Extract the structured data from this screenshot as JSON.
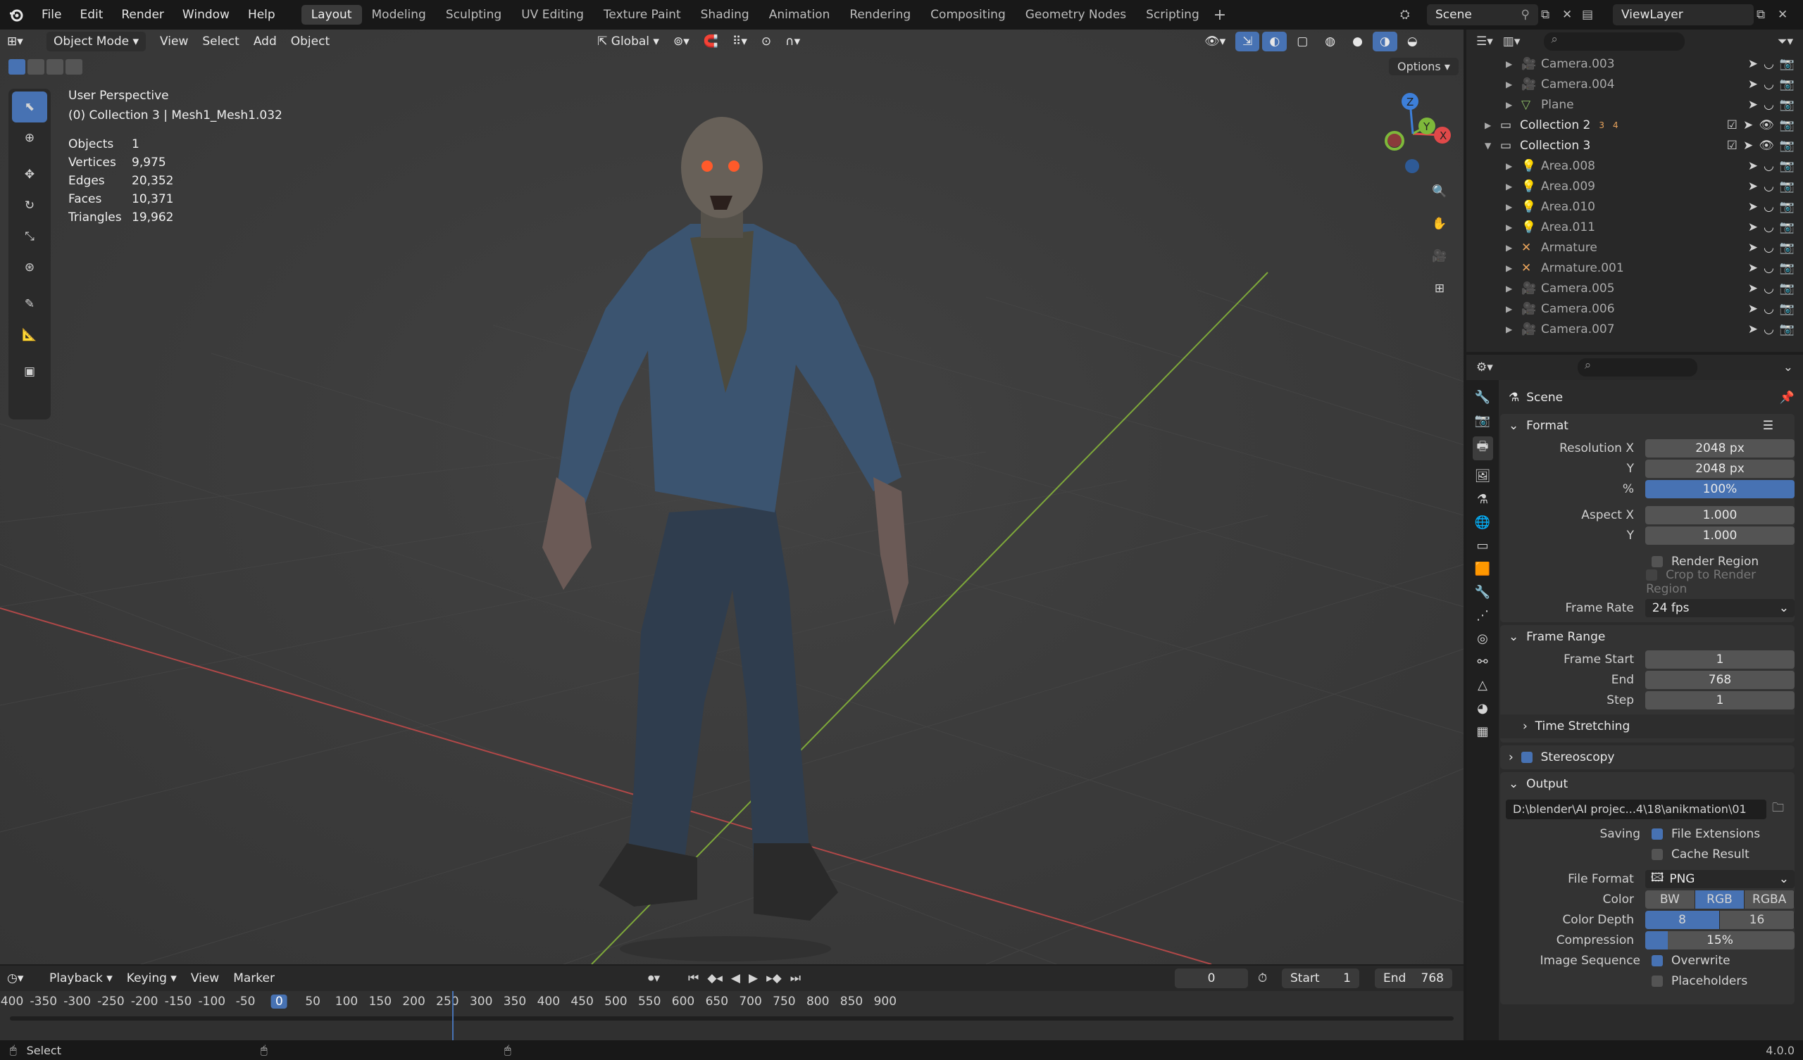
{
  "app": {
    "version": "4.0.0"
  },
  "menu": [
    "File",
    "Edit",
    "Render",
    "Window",
    "Help"
  ],
  "workspaces": [
    {
      "label": "Layout",
      "active": true
    },
    {
      "label": "Modeling"
    },
    {
      "label": "Sculpting"
    },
    {
      "label": "UV Editing"
    },
    {
      "label": "Texture Paint"
    },
    {
      "label": "Shading"
    },
    {
      "label": "Animation"
    },
    {
      "label": "Rendering"
    },
    {
      "label": "Compositing"
    },
    {
      "label": "Geometry Nodes"
    },
    {
      "label": "Scripting"
    }
  ],
  "scene_selector": "Scene",
  "view_layer": "ViewLayer",
  "viewport_header": {
    "mode": "Object Mode",
    "menus": [
      "View",
      "Select",
      "Add",
      "Object"
    ],
    "orientation": "Global",
    "options": "Options"
  },
  "viewport": {
    "perspective": "User Perspective",
    "context": "(0) Collection 3 | Mesh1_Mesh1.032",
    "stats": [
      {
        "k": "Objects",
        "v": "1"
      },
      {
        "k": "Vertices",
        "v": "9,975"
      },
      {
        "k": "Edges",
        "v": "20,352"
      },
      {
        "k": "Faces",
        "v": "10,371"
      },
      {
        "k": "Triangles",
        "v": "19,962"
      }
    ],
    "gizmo": {
      "x": "X",
      "y": "Y",
      "z": "Z"
    }
  },
  "outliner": {
    "rows": [
      {
        "name": "Camera.003",
        "type": "camera",
        "indent": 2
      },
      {
        "name": "Camera.004",
        "type": "camera",
        "indent": 2
      },
      {
        "name": "Plane",
        "type": "mesh",
        "indent": 2
      },
      {
        "name": "Collection 2",
        "type": "collection",
        "indent": 1,
        "badges": [
          "3",
          "4"
        ]
      },
      {
        "name": "Collection 3",
        "type": "collection",
        "indent": 1,
        "expanded": true
      },
      {
        "name": "Area.008",
        "type": "light",
        "indent": 2
      },
      {
        "name": "Area.009",
        "type": "light",
        "indent": 2
      },
      {
        "name": "Area.010",
        "type": "light",
        "indent": 2
      },
      {
        "name": "Area.011",
        "type": "light",
        "indent": 2
      },
      {
        "name": "Armature",
        "type": "armature",
        "indent": 2
      },
      {
        "name": "Armature.001",
        "type": "armature",
        "indent": 2
      },
      {
        "name": "Camera.005",
        "type": "camera",
        "indent": 2
      },
      {
        "name": "Camera.006",
        "type": "camera",
        "indent": 2
      },
      {
        "name": "Camera.007",
        "type": "camera",
        "indent": 2
      }
    ]
  },
  "properties": {
    "context": "Scene",
    "format": {
      "title": "Format",
      "res_x_label": "Resolution X",
      "res_x": "2048 px",
      "res_y_label": "Y",
      "res_y": "2048 px",
      "pct_label": "%",
      "pct": "100%",
      "aspect_x_label": "Aspect X",
      "aspect_x": "1.000",
      "aspect_y_label": "Y",
      "aspect_y": "1.000",
      "render_region": "Render Region",
      "crop": "Crop to Render Region",
      "frame_rate_label": "Frame Rate",
      "frame_rate": "24 fps"
    },
    "frame_range": {
      "title": "Frame Range",
      "start_label": "Frame Start",
      "start": "1",
      "end_label": "End",
      "end": "768",
      "step_label": "Step",
      "step": "1",
      "time_stretching": "Time Stretching"
    },
    "stereoscopy": "Stereoscopy",
    "output": {
      "title": "Output",
      "path": "D:\\blender\\AI projec...4\\18\\anikmation\\01",
      "saving_label": "Saving",
      "file_ext": "File Extensions",
      "cache": "Cache Result",
      "file_format_label": "File Format",
      "file_format": "PNG",
      "color_label": "Color",
      "color_opts": [
        "BW",
        "RGB",
        "RGBA"
      ],
      "depth_label": "Color Depth",
      "depth_opts": [
        "8",
        "16"
      ],
      "compression_label": "Compression",
      "compression": "15%",
      "compression_frac": 0.15,
      "image_seq_label": "Image Sequence",
      "overwrite": "Overwrite",
      "placeholders": "Placeholders"
    }
  },
  "timeline": {
    "menus": [
      "Playback",
      "Keying",
      "View",
      "Marker"
    ],
    "current_frame": "0",
    "start_label": "Start",
    "start": "1",
    "end_label": "End",
    "end": "768",
    "ruler": [
      "-400",
      "-350",
      "-300",
      "-250",
      "-200",
      "-150",
      "-100",
      "-50",
      "0",
      "50",
      "100",
      "150",
      "200",
      "250",
      "300",
      "350",
      "400",
      "450",
      "500",
      "550",
      "600",
      "650",
      "700",
      "750",
      "800",
      "850",
      "900"
    ]
  },
  "statusbar": {
    "left": "Select"
  }
}
